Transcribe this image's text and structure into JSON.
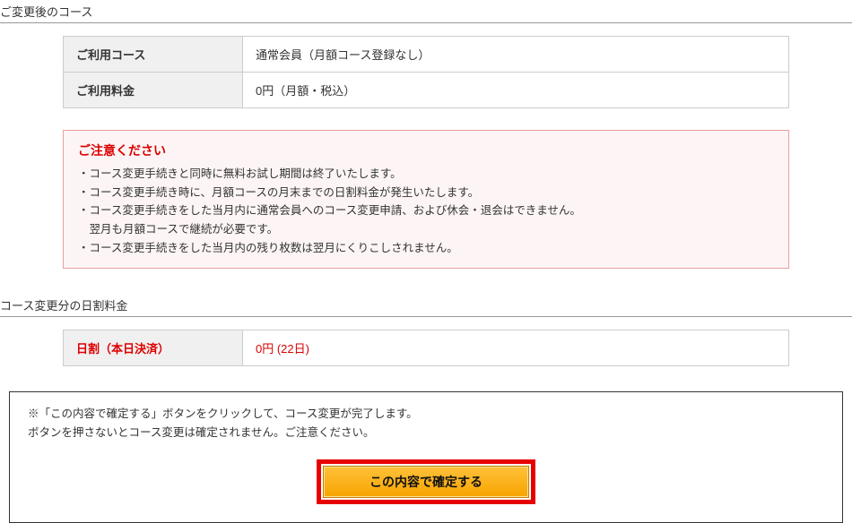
{
  "sections": {
    "afterChange": {
      "title": "ご変更後のコース",
      "rows": [
        {
          "label": "ご利用コース",
          "value": "通常会員（月額コース登録なし）"
        },
        {
          "label": "ご利用料金",
          "value": "0円（月額・税込）"
        }
      ]
    },
    "notice": {
      "title": "ご注意ください",
      "items": [
        "コース変更手続きと同時に無料お試し期間は終了いたします。",
        "コース変更手続き時に、月額コースの月末までの日割料金が発生いたします。",
        "コース変更手続きをした当月内に通常会員へのコース変更申請、および休会・退会はできません。",
        "翌月も月額コースで継続が必要です。",
        "コース変更手続きをした当月内の残り枚数は翌月にくりこしされません。"
      ]
    },
    "prorated": {
      "title": "コース変更分の日割料金",
      "rows": [
        {
          "label": "日割（本日決済）",
          "value": "0円 (22日)"
        }
      ]
    },
    "confirm": {
      "line1": "※「この内容で確定する」ボタンをクリックして、コース変更が完了します。",
      "line2": "ボタンを押さないとコース変更は確定されません。ご注意ください。",
      "button": "この内容で確定する"
    }
  }
}
